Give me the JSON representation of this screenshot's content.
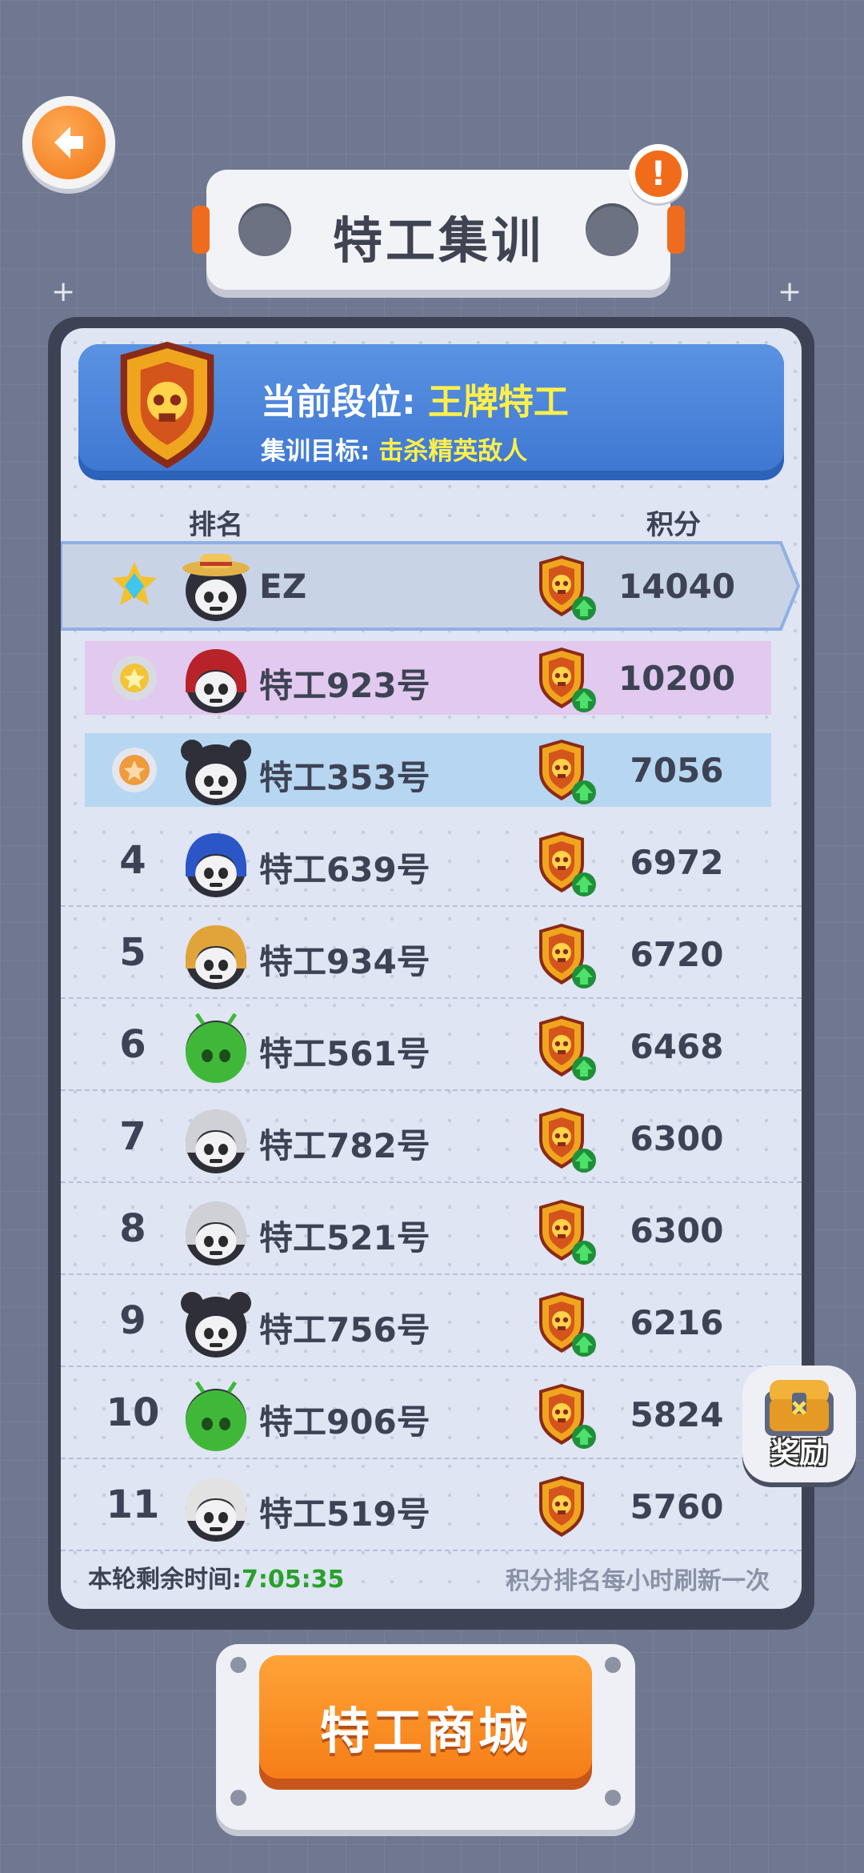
{
  "title": "特工集训",
  "header": {
    "current_label": "当前段位:",
    "current_value": "王牌特工",
    "goal_label": "集训目标:",
    "goal_value": "击杀精英敌人"
  },
  "columns": {
    "rank": "排名",
    "score": "积分"
  },
  "players": [
    {
      "rank": "1",
      "name": "EZ",
      "score": "14040",
      "medal": "diamond-star-medal",
      "highlight": "self"
    },
    {
      "rank": "2",
      "name": "特工923号",
      "score": "10200",
      "medal": "silver-star-medal",
      "highlight": "purple"
    },
    {
      "rank": "3",
      "name": "特工353号",
      "score": "7056",
      "medal": "bronze-star-medal",
      "highlight": "blue"
    },
    {
      "rank": "4",
      "name": "特工639号",
      "score": "6972"
    },
    {
      "rank": "5",
      "name": "特工934号",
      "score": "6720"
    },
    {
      "rank": "6",
      "name": "特工561号",
      "score": "6468"
    },
    {
      "rank": "7",
      "name": "特工782号",
      "score": "6300"
    },
    {
      "rank": "8",
      "name": "特工521号",
      "score": "6300"
    },
    {
      "rank": "9",
      "name": "特工756号",
      "score": "6216"
    },
    {
      "rank": "10",
      "name": "特工906号",
      "score": "5824"
    },
    {
      "rank": "11",
      "name": "特工519号",
      "score": "5760"
    }
  ],
  "footer": {
    "remaining_label": "本轮剩余时间:",
    "remaining_time": "7:05:35",
    "refresh_note": "积分排名每小时刷新一次"
  },
  "reward_label": "奖励",
  "shop_label": "特工商城",
  "colors": {
    "accent_orange": "#f57d17",
    "header_blue": "#4a84da",
    "gold_text": "#fff04a",
    "timer_green": "#29a12b",
    "highlight_purple": "#e2c9ef",
    "highlight_blue": "#b7d6f2"
  }
}
